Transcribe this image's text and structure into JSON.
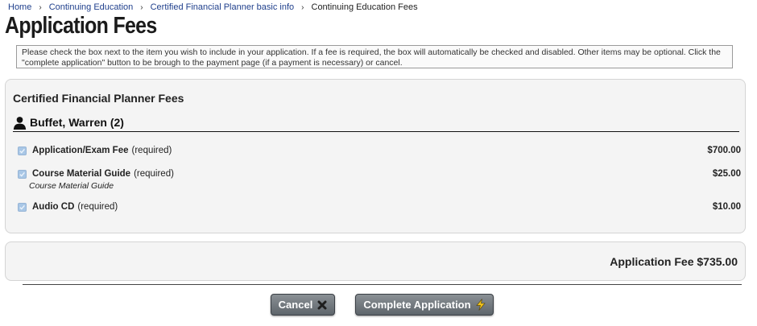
{
  "breadcrumb": {
    "items": [
      "Home",
      "Continuing Education",
      "Certified Financial Planner basic info"
    ],
    "current": "Continuing Education Fees"
  },
  "page": {
    "title": "Application Fees",
    "instructions": "Please check the box next to the item you wish to include in your application. If a fee is required, the box will automatically be checked and disabled. Other items may be optional. Click the \"complete application\" button to be brough to the payment page (if a payment is necessary) or cancel."
  },
  "fees_panel": {
    "title": "Certified Financial Planner Fees",
    "person": "Buffet, Warren (2)",
    "items": [
      {
        "name": "Application/Exam Fee",
        "requirement": "(required)",
        "amount": "$700.00",
        "checked": true,
        "disabled": true
      },
      {
        "name": "Course Material Guide",
        "requirement": "(required)",
        "amount": "$25.00",
        "sub": "Course Material Guide",
        "checked": true,
        "disabled": true
      },
      {
        "name": "Audio CD",
        "requirement": "(required)",
        "amount": "$10.00",
        "checked": true,
        "disabled": true
      }
    ]
  },
  "total": {
    "label": "Application Fee $735.00"
  },
  "buttons": {
    "cancel": "Cancel",
    "complete": "Complete Application"
  },
  "icons": {
    "cancel": "close-icon",
    "complete": "lightning-icon",
    "person": "person-icon"
  },
  "colors": {
    "link": "#1f3f8c",
    "button": "#6b7278",
    "lightning": "#f2c31b",
    "checkbox": "#a9c7e6"
  }
}
